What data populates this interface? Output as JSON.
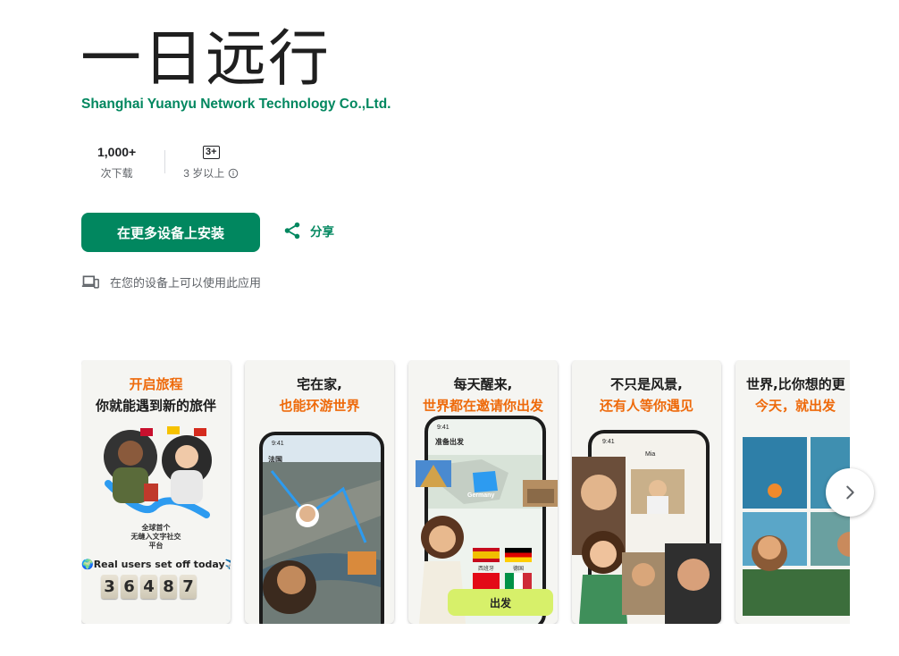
{
  "app": {
    "title": "一日远行",
    "developer": "Shanghai Yuanyu Network Technology Co.,Ltd."
  },
  "stats": {
    "downloads_value": "1,000+",
    "downloads_label": "次下载",
    "rating_badge": "3+",
    "rating_label": "3 岁以上"
  },
  "actions": {
    "install_label": "在更多设备上安装",
    "share_label": "分享"
  },
  "device_note": "在您的设备上可以使用此应用",
  "screenshots": [
    {
      "line1": "开启旅程",
      "line2": "你就能遇到新的旅伴",
      "badge_line1": "全球首个",
      "badge_line2": "无缝入文字社交",
      "badge_line3": "平台",
      "real_users": "🌍Real users set off today✈️",
      "counter": [
        "3",
        "6",
        "4",
        "8",
        "7"
      ]
    },
    {
      "line1": "宅在家,",
      "line2": "也能环游世界",
      "phone_time": "9:41",
      "phone_loc": "法国"
    },
    {
      "line1": "每天醒来,",
      "line2": "世界都在邀请你出发",
      "phone_time": "9:41",
      "phone_header": "准备出发",
      "country": "Germany",
      "flag_a": "西班牙",
      "flag_b": "德国",
      "go_label": "出发"
    },
    {
      "line1": "不只是风景,",
      "line2": "还有人等你遇见",
      "phone_time": "9:41",
      "chat_name": "Mia"
    },
    {
      "line1": "世界,比你想的更",
      "line2": "今天，就出发"
    }
  ],
  "colors": {
    "brand_green": "#01875f",
    "caption_orange": "#ee6a0b"
  }
}
